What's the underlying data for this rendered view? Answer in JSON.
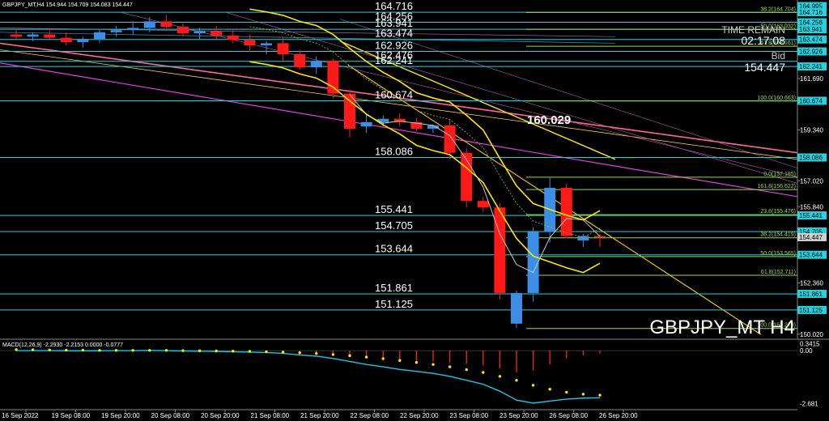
{
  "header": {
    "symbol_info": "GBPJPY_MT,H4  154.944 154.709 154.083 154.447",
    "time_remain_label": "TIME REMAIN",
    "time_remain_value": "02:17:08",
    "bid_label": "Bid",
    "bid_value": "154.447",
    "watermark": "GBPJPY_MT H4"
  },
  "colors": {
    "background": "#000000",
    "bull": "#3d8fe6",
    "bear": "#ff1a1a",
    "level_line": "#22d3e0",
    "fib_line": "#9cd84a",
    "fib_label": "#9cd84a",
    "yellow": "#ffe600",
    "magenta": "#e040e0",
    "pink": "#ff6699",
    "macd_line": "#1ec6e6",
    "macd_hist": "#ff2020",
    "axis_text": "#ffffff",
    "price_box": "#22d3e0"
  },
  "chart_data": {
    "type": "candlestick",
    "symbol": "GBPJPY_MT",
    "timeframe": "H4",
    "ylim": [
      149.9,
      165.2
    ],
    "y_ticks": [
      161.69,
      159.34,
      157.02,
      155.84,
      152.36,
      150.02
    ],
    "x_ticks": [
      "16 Sep 2022",
      "19 Sep 08:00",
      "19 Sep 20:00",
      "20 Sep 08:00",
      "20 Sep 20:00",
      "21 Sep 08:00",
      "21 Sep 20:00",
      "22 Sep 08:00",
      "22 Sep 20:00",
      "23 Sep 08:00",
      "23 Sep 20:00",
      "26 Sep 08:00",
      "26 Sep 20:00"
    ],
    "candles": [
      {
        "o": 163.7,
        "h": 163.9,
        "l": 163.5,
        "c": 163.6
      },
      {
        "o": 163.6,
        "h": 163.8,
        "l": 163.4,
        "c": 163.7
      },
      {
        "o": 163.7,
        "h": 164.0,
        "l": 163.5,
        "c": 163.55
      },
      {
        "o": 163.55,
        "h": 163.8,
        "l": 163.2,
        "c": 163.35
      },
      {
        "o": 163.35,
        "h": 163.6,
        "l": 163.1,
        "c": 163.5
      },
      {
        "o": 163.5,
        "h": 163.9,
        "l": 163.3,
        "c": 163.8
      },
      {
        "o": 163.8,
        "h": 164.1,
        "l": 163.6,
        "c": 163.9
      },
      {
        "o": 163.9,
        "h": 164.3,
        "l": 163.7,
        "c": 164.0
      },
      {
        "o": 164.0,
        "h": 164.5,
        "l": 163.8,
        "c": 164.3
      },
      {
        "o": 164.3,
        "h": 164.6,
        "l": 164.0,
        "c": 164.05
      },
      {
        "o": 164.05,
        "h": 164.2,
        "l": 163.6,
        "c": 163.75
      },
      {
        "o": 163.75,
        "h": 164.0,
        "l": 163.5,
        "c": 163.85
      },
      {
        "o": 163.85,
        "h": 164.1,
        "l": 163.5,
        "c": 163.65
      },
      {
        "o": 163.65,
        "h": 163.9,
        "l": 163.3,
        "c": 163.45
      },
      {
        "o": 163.45,
        "h": 163.7,
        "l": 162.9,
        "c": 163.2
      },
      {
        "o": 163.2,
        "h": 163.4,
        "l": 162.8,
        "c": 163.3
      },
      {
        "o": 163.3,
        "h": 163.6,
        "l": 162.5,
        "c": 162.8
      },
      {
        "o": 162.8,
        "h": 163.0,
        "l": 162.1,
        "c": 162.2
      },
      {
        "o": 162.2,
        "h": 162.7,
        "l": 161.9,
        "c": 162.5
      },
      {
        "o": 162.5,
        "h": 162.6,
        "l": 160.8,
        "c": 161.0
      },
      {
        "o": 161.0,
        "h": 161.2,
        "l": 159.0,
        "c": 159.4
      },
      {
        "o": 159.5,
        "h": 160.0,
        "l": 159.2,
        "c": 159.7
      },
      {
        "o": 159.7,
        "h": 160.0,
        "l": 159.5,
        "c": 159.85
      },
      {
        "o": 159.85,
        "h": 160.1,
        "l": 159.5,
        "c": 159.7
      },
      {
        "o": 159.7,
        "h": 159.9,
        "l": 159.3,
        "c": 159.4
      },
      {
        "o": 159.4,
        "h": 159.6,
        "l": 159.2,
        "c": 159.55
      },
      {
        "o": 159.55,
        "h": 159.8,
        "l": 158.0,
        "c": 158.3
      },
      {
        "o": 158.3,
        "h": 158.5,
        "l": 155.8,
        "c": 156.1
      },
      {
        "o": 156.1,
        "h": 156.3,
        "l": 155.6,
        "c": 155.8
      },
      {
        "o": 155.8,
        "h": 156.0,
        "l": 151.6,
        "c": 151.9
      },
      {
        "o": 150.5,
        "h": 152.0,
        "l": 150.3,
        "c": 151.9
      },
      {
        "o": 151.9,
        "h": 154.9,
        "l": 151.5,
        "c": 154.7
      },
      {
        "o": 154.7,
        "h": 157.2,
        "l": 154.2,
        "c": 156.7
      },
      {
        "o": 156.7,
        "h": 156.9,
        "l": 154.4,
        "c": 154.5
      },
      {
        "o": 154.3,
        "h": 154.6,
        "l": 154.0,
        "c": 154.5
      },
      {
        "o": 154.5,
        "h": 154.6,
        "l": 154.0,
        "c": 154.447
      }
    ],
    "levels": [
      {
        "value": 164.716,
        "label": "164.716"
      },
      {
        "value": 164.256,
        "label": "164.256"
      },
      {
        "value": 163.941,
        "label": "163.941"
      },
      {
        "value": 163.474,
        "label": "163.474"
      },
      {
        "value": 162.926,
        "label": "162.926"
      },
      {
        "value": 162.476,
        "label": "162.476"
      },
      {
        "value": 162.241,
        "label": "162.241"
      },
      {
        "value": 160.674,
        "label": "160.674"
      },
      {
        "value": 158.086,
        "label": "158.086"
      },
      {
        "value": 155.441,
        "label": "155.441"
      },
      {
        "value": 154.705,
        "label": "154.705"
      },
      {
        "value": 153.644,
        "label": "153.644"
      },
      {
        "value": 151.861,
        "label": "151.861"
      },
      {
        "value": 151.125,
        "label": "151.125"
      }
    ],
    "fib_levels": [
      {
        "value": 164.704,
        "label": "38.2(164.704)"
      },
      {
        "value": 163.932,
        "label": "50.0(163.932)"
      },
      {
        "value": 163.161,
        "label": "61.8(163.161)"
      },
      {
        "value": 160.663,
        "label": "100.0(160.663)"
      },
      {
        "value": 157.185,
        "label": "0.0(157.185)"
      },
      {
        "value": 156.622,
        "label": "161.8(156.622)"
      },
      {
        "value": 155.476,
        "label": "23.6(155.476)"
      },
      {
        "value": 154.419,
        "label": "38.2(154.419)"
      },
      {
        "value": 153.565,
        "label": "50.0(153.565)"
      },
      {
        "value": 152.711,
        "label": "61.8(152.711)"
      },
      {
        "value": 150.279,
        "label": "100.0(150.279)"
      }
    ],
    "price_boxes": [
      "164.995",
      "164.716",
      "164.256",
      "163.941",
      "163.474",
      "162.926",
      "162.241",
      "160.674",
      "158.086",
      "155.441",
      "154.705",
      "154.447",
      "153.644",
      "151.861",
      "151.125"
    ],
    "annotation": "160.029",
    "macd": {
      "label": "MACD(12,26,9) -2.2930 -2.2153 0.0000 -0.0777",
      "ylim": [
        -2.9,
        0.45
      ],
      "y_ticks": [
        "0.3415",
        "0.00",
        "-2.681"
      ],
      "line": [
        0.0,
        0.0,
        0.0,
        -0.01,
        -0.01,
        -0.01,
        0.0,
        0.0,
        0.01,
        0.0,
        -0.02,
        -0.03,
        -0.04,
        -0.06,
        -0.08,
        -0.1,
        -0.14,
        -0.22,
        -0.28,
        -0.4,
        -0.55,
        -0.7,
        -0.82,
        -0.95,
        -1.05,
        -1.15,
        -1.3,
        -1.5,
        -1.7,
        -2.05,
        -2.5,
        -2.65,
        -2.55,
        -2.45,
        -2.4,
        -2.38
      ],
      "signal": [
        0.05,
        0.04,
        0.03,
        0.02,
        0.02,
        0.01,
        0.01,
        0.01,
        0.01,
        0.01,
        0.0,
        -0.01,
        -0.02,
        -0.03,
        -0.04,
        -0.06,
        -0.08,
        -0.11,
        -0.15,
        -0.2,
        -0.26,
        -0.33,
        -0.41,
        -0.5,
        -0.6,
        -0.7,
        -0.82,
        -0.96,
        -1.1,
        -1.3,
        -1.5,
        -1.75,
        -1.95,
        -2.1,
        -2.2,
        -2.25
      ],
      "hist": [
        0.05,
        0.1,
        0.08,
        0.02,
        0.0,
        0.0,
        0.03,
        0.06,
        0.08,
        0.07,
        0.0,
        -0.02,
        -0.03,
        -0.04,
        -0.05,
        -0.06,
        -0.07,
        -0.12,
        -0.15,
        -0.22,
        -0.3,
        -0.38,
        -0.45,
        -0.5,
        -0.52,
        -0.55,
        -0.6,
        -0.68,
        -0.75,
        -0.9,
        -1.1,
        -1.0,
        -0.7,
        -0.4,
        -0.25,
        -0.15
      ]
    }
  }
}
